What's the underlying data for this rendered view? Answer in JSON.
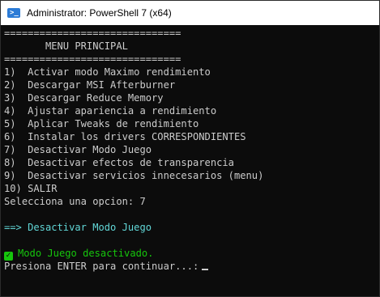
{
  "window": {
    "title": "Administrator: PowerShell 7 (x64)",
    "icon": "powershell-icon"
  },
  "console": {
    "separator_top": "==============================",
    "menu_title": "       MENU PRINCIPAL",
    "separator_bottom": "==============================",
    "menu_items": [
      "1)  Activar modo Maximo rendimiento",
      "2)  Descargar MSI Afterburner",
      "3)  Descargar Reduce Memory",
      "4)  Ajustar apariencia a rendimiento",
      "5)  Aplicar Tweaks de rendimiento",
      "6)  Instalar los drivers CORRESPONDIENTES",
      "7)  Desactivar Modo Juego",
      "8)  Desactivar efectos de transparencia",
      "9)  Desactivar servicios innecesarios (menu)",
      "10) SALIR"
    ],
    "prompt": "Selecciona una opcion: 7",
    "action_line": "==> Desactivar Modo Juego",
    "result_icon": "check-icon",
    "result_text": "Modo Juego desactivado.",
    "continue_prompt": "Presiona ENTER para continuar...:",
    "colors": {
      "background": "#0c0c0c",
      "text": "#cccccc",
      "cyan": "#61d6d6",
      "green": "#16c60c"
    }
  }
}
